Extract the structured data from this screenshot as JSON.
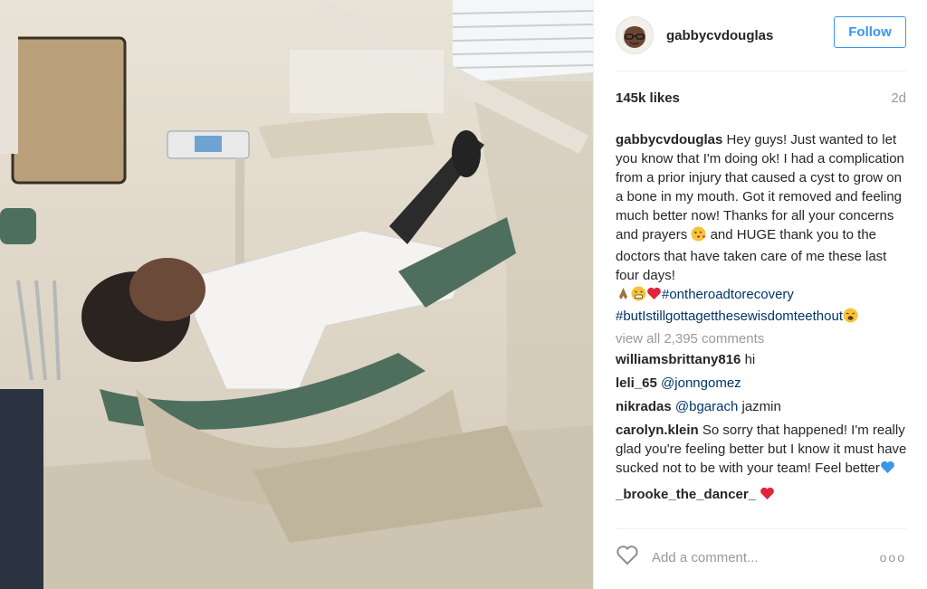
{
  "post": {
    "username": "gabbycvdouglas",
    "follow_label": "Follow",
    "likes": "145k likes",
    "age": "2d",
    "caption_user": "gabbycvdouglas",
    "caption_text": "Hey guys! Just wanted to let you know that I'm doing ok! I had a complication from a prior injury that caused a cyst to grow on a bone in my mouth. Got it removed and feeling much better now! Thanks for all your concerns and prayers",
    "caption_text_2": "and HUGE thank you to the doctors that have taken care of me these last four days!",
    "hashtag_1": "#ontheroadtorecovery",
    "hashtag_2": "#butIstillgottagetthesewisdomteethout",
    "emojis": [
      "kiss-emoji",
      "praying-hands-emoji",
      "grimace-emoji",
      "red-heart-emoji",
      "weary-emoji"
    ],
    "view_all": "view all 2,395 comments"
  },
  "comments": [
    {
      "user": "williamsbrittany816",
      "mention": "",
      "text": "hi"
    },
    {
      "user": "leli_65",
      "mention": "@jonngomez",
      "text": ""
    },
    {
      "user": "nikradas",
      "mention": "@bgarach",
      "text": "jazmin"
    },
    {
      "user": "carolyn.klein",
      "mention": "",
      "text": "So sorry that happened! I'm really glad you're feeling better but I know it must have sucked not to be with your team! Feel better"
    },
    {
      "user": "_brooke_the_dancer_",
      "mention": "",
      "text": ""
    }
  ],
  "add_comment": {
    "placeholder": "Add a comment...",
    "more": "ooo"
  },
  "colors": {
    "accent": "#3897f0",
    "hashtag": "#003569",
    "muted": "#999999",
    "heart": "#e0243a",
    "blue_heart": "#3b97e8"
  }
}
